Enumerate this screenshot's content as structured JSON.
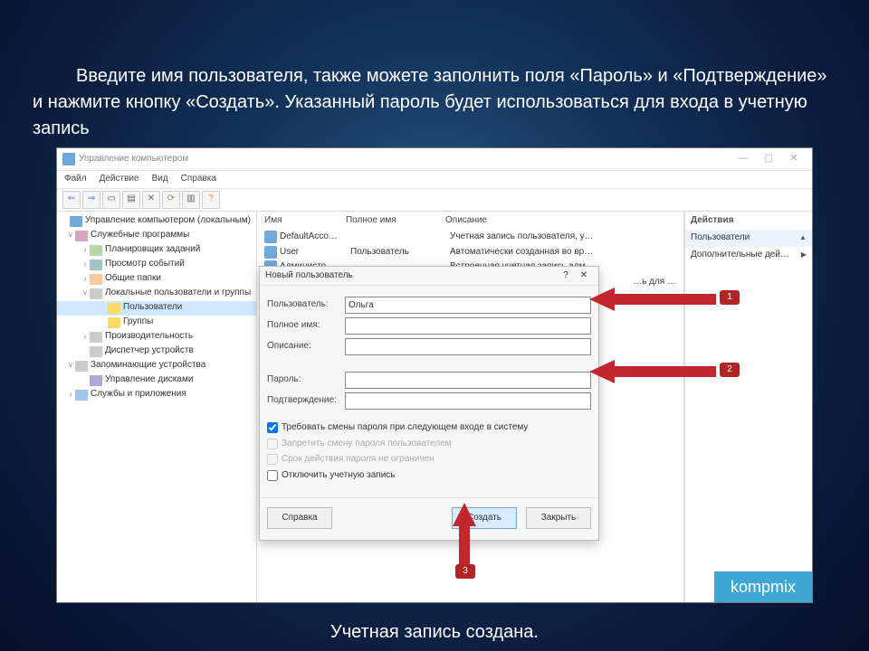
{
  "instruction": "Введите имя пользователя, также можете заполнить поля «Пароль» и «Подтверждение» и нажмите кнопку «Создать». Указанный пароль будет использоваться для входа в учетную запись",
  "footer": "Учетная запись создана.",
  "window": {
    "title": "Управление компьютером",
    "menubar": [
      "Файл",
      "Действие",
      "Вид",
      "Справка"
    ],
    "win_min": "—",
    "win_max": "▢",
    "win_close": "✕",
    "help_mark": "?",
    "dlg_close": "✕"
  },
  "tree": {
    "root": "Управление компьютером (локальным)",
    "n1": "Служебные программы",
    "n1a": "Планировщик заданий",
    "n1b": "Просмотр событий",
    "n1c": "Общие папки",
    "n1d": "Локальные пользователи и группы",
    "n1d1": "Пользователи",
    "n1d2": "Группы",
    "n1e": "Производительность",
    "n1f": "Диспетчер устройств",
    "n2": "Запоминающие устройства",
    "n2a": "Управление дисками",
    "n3": "Службы и приложения"
  },
  "cols": {
    "c1": "Имя",
    "c2": "Полное имя",
    "c3": "Описание"
  },
  "users": {
    "u1": {
      "name": "DefaultAcco…",
      "full": "",
      "desc": "Учетная запись пользователя, у…"
    },
    "u2": {
      "name": "User",
      "full": "Пользователь",
      "desc": "Автоматически созданная во вр…"
    },
    "u3": {
      "name": "Администо…",
      "full": "",
      "desc": "Встроенная учетная запись адм…"
    },
    "u4": {
      "name": "",
      "full": "",
      "desc": "…ь для …"
    }
  },
  "actions": {
    "head": "Действия",
    "item": "Пользователи",
    "sub": "Дополнительные дей…"
  },
  "dialog": {
    "title": "Новый пользователь",
    "user_lbl": "Пользователь:",
    "user_val": "Ольга",
    "full_lbl": "Полное имя:",
    "desc_lbl": "Описание:",
    "pass_lbl": "Пароль:",
    "conf_lbl": "Подтверждение:",
    "chk1": "Требовать смены пароля при следующем входе в систему",
    "chk2": "Запретить смену пароля пользователем",
    "chk3": "Срок действия пароля не ограничен",
    "chk4": "Отключить учетную запись",
    "btn_help": "Справка",
    "btn_create": "Создать",
    "btn_close": "Закрыть"
  },
  "badges": {
    "b1": "1",
    "b2": "2",
    "b3": "3"
  },
  "watermark": "kompmix"
}
